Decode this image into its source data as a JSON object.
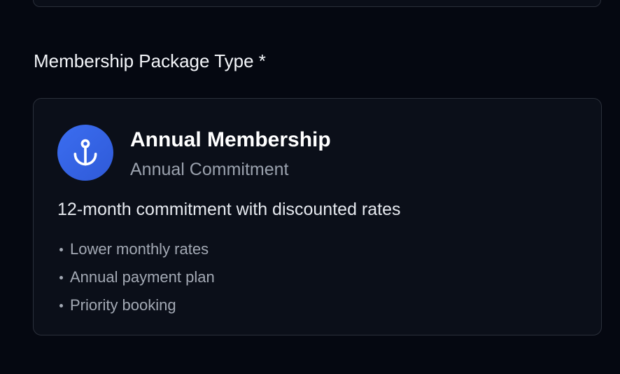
{
  "form": {
    "field_label": "Membership Package Type *"
  },
  "package": {
    "icon": "anchor-icon",
    "icon_color": "#3b6df0",
    "title": "Annual Membership",
    "subtitle": "Annual Commitment",
    "description": "12-month commitment with discounted rates",
    "features": [
      "Lower monthly rates",
      "Annual payment plan",
      "Priority booking"
    ]
  }
}
